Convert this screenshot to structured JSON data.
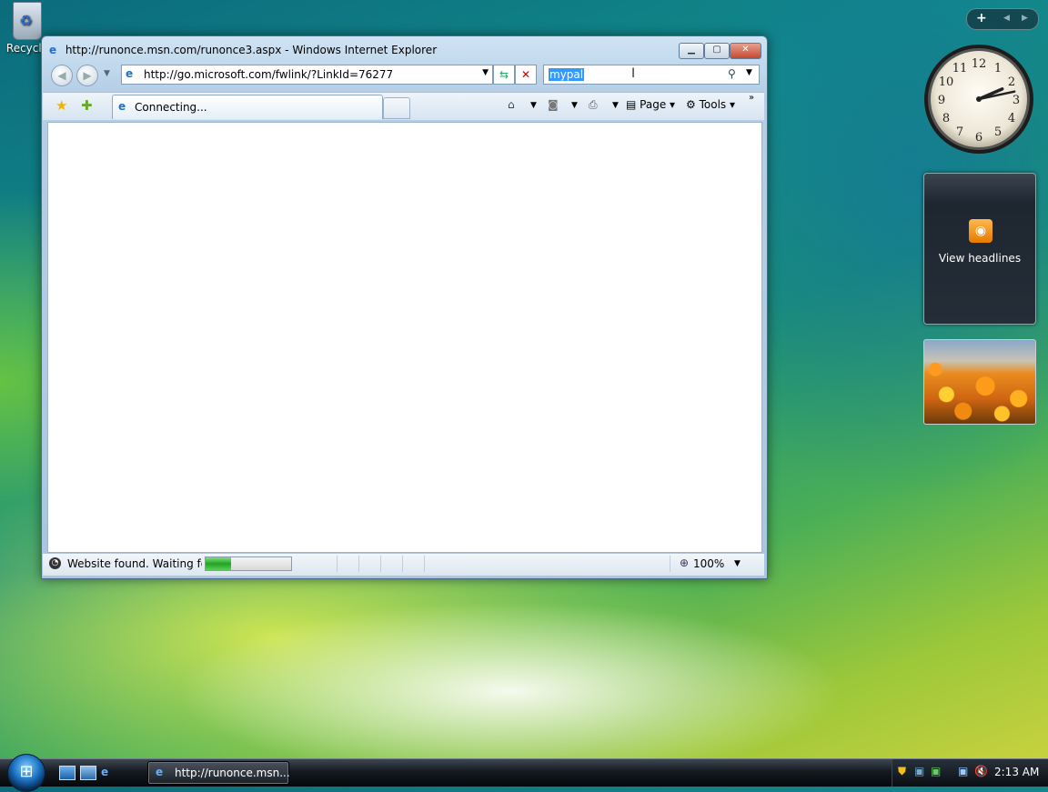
{
  "desktop": {
    "recycle_bin_label": "Recycle"
  },
  "browser": {
    "title": "http://runonce.msn.com/runonce3.aspx - Windows Internet Explorer",
    "address": "http://go.microsoft.com/fwlink/?LinkId=76277",
    "search_value": "mypal",
    "tab_label": "Connecting...",
    "toolbar": {
      "page_label": "Page",
      "tools_label": "Tools"
    },
    "status_text": "Website found. Waiting for r",
    "progress": 0.3,
    "zoom": "100%"
  },
  "sidebar": {
    "feed_label": "View headlines",
    "clock": {
      "hour": 2,
      "minute": 13
    }
  },
  "taskbar": {
    "task_label": "http://runonce.msn...",
    "time": "2:13 AM"
  },
  "icons": [
    "recycle-bin-icon",
    "ie-icon",
    "back-icon",
    "forward-icon",
    "refresh-icon",
    "stop-icon",
    "search-icon",
    "favorites-star-icon",
    "add-favorites-icon",
    "home-icon",
    "feeds-icon",
    "print-icon",
    "page-icon",
    "tools-gear-icon",
    "zoom-icon",
    "rss-icon",
    "start-orb-icon",
    "shield-icon",
    "network-icon",
    "volume-muted-icon"
  ]
}
